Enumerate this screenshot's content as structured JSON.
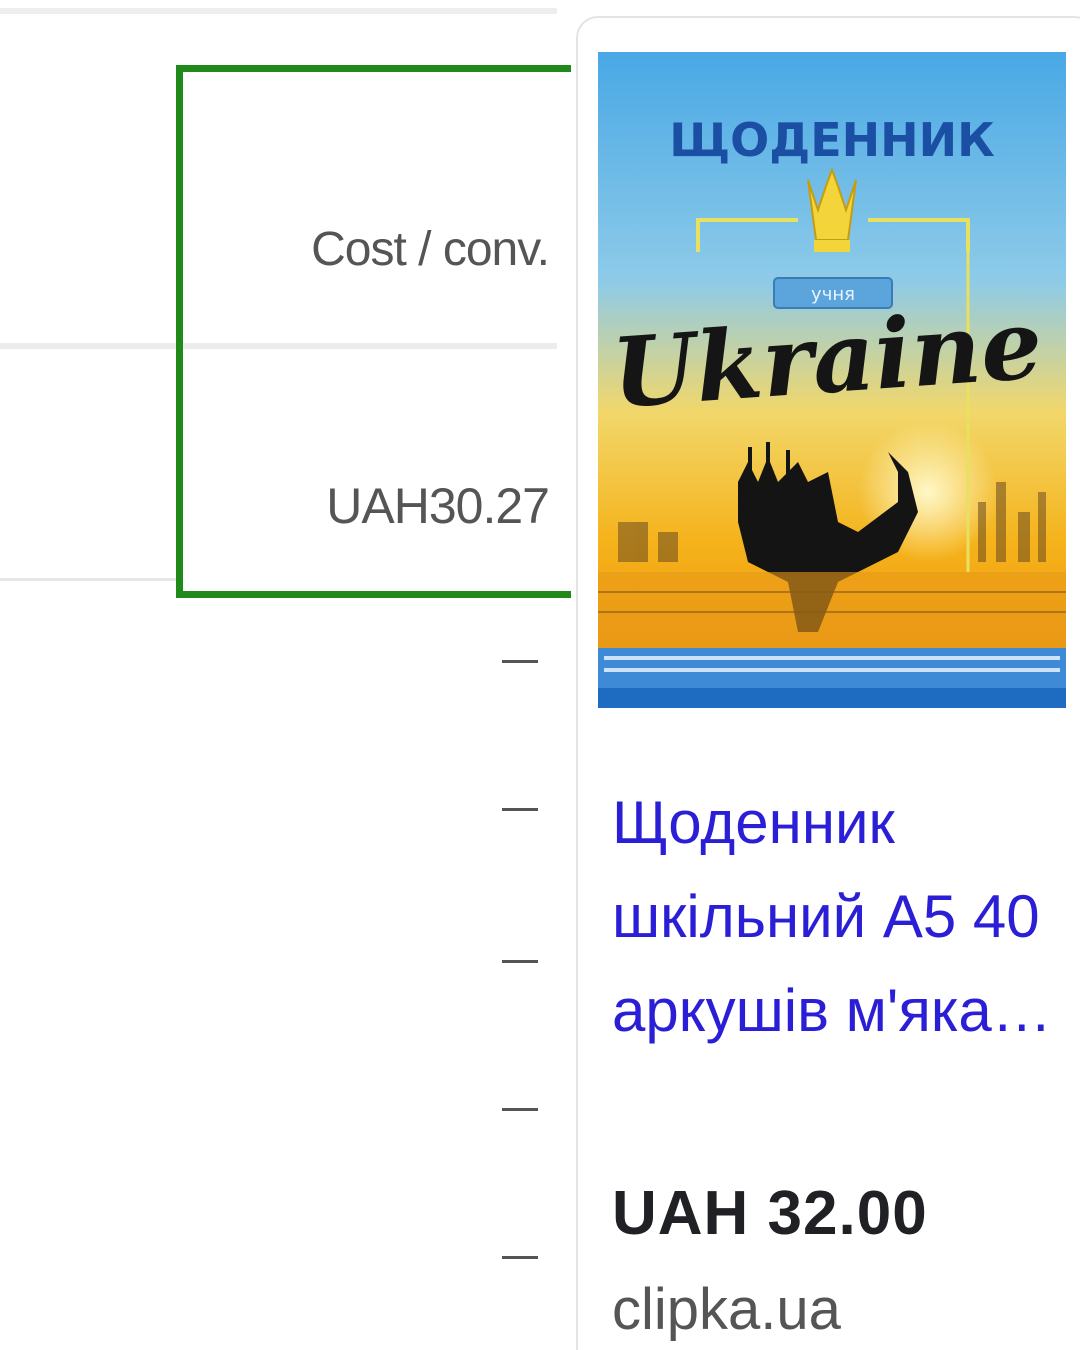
{
  "table": {
    "column_header": "Cost / conv.",
    "cell_value": "UAH30.27",
    "empty_cells": [
      "–",
      "–",
      "–",
      "–",
      "–"
    ]
  },
  "product_card": {
    "image": {
      "title": "ЩОДЕННИК",
      "script_word": "Ukraine",
      "ribbon": "учня"
    },
    "title": "Щоденник шкільний А5 40 аркушів м'яка…",
    "price": "UAH 32.00",
    "merchant": "clipka.ua"
  },
  "colors": {
    "highlight_border": "#1f8a1a",
    "link": "#2a1fd6",
    "muted_text": "#555555"
  }
}
